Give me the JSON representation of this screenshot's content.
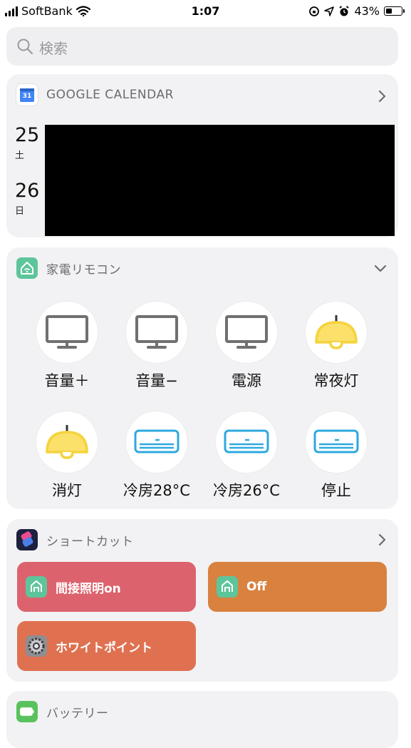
{
  "status_bar": {
    "carrier": "SoftBank",
    "time": "1:07",
    "battery_percent": "43%",
    "battery_level": 0.43
  },
  "search": {
    "placeholder": "検索",
    "icon": "search-icon"
  },
  "calendar_widget": {
    "title": "GOOGLE CALENDAR",
    "icon": "google-calendar-icon",
    "icon_day": "31",
    "days": [
      {
        "date": "25",
        "weekday": "土"
      },
      {
        "date": "26",
        "weekday": "日"
      }
    ]
  },
  "remote_widget": {
    "title": "家電リモコン",
    "icon": "home-remote-icon",
    "buttons": [
      {
        "label": "音量＋",
        "icon": "tv-icon"
      },
      {
        "label": "音量−",
        "icon": "tv-icon"
      },
      {
        "label": "電源",
        "icon": "tv-icon"
      },
      {
        "label": "常夜灯",
        "icon": "ceiling-lamp-icon"
      },
      {
        "label": "消灯",
        "icon": "ceiling-lamp-icon"
      },
      {
        "label": "冷房28°C",
        "icon": "air-conditioner-icon"
      },
      {
        "label": "冷房26°C",
        "icon": "air-conditioner-icon"
      },
      {
        "label": "停止",
        "icon": "air-conditioner-icon"
      }
    ]
  },
  "shortcuts_widget": {
    "title": "ショートカット",
    "icon": "shortcuts-icon",
    "buttons": [
      {
        "label": "間接照明on",
        "color": "#dc636d",
        "icon": "home-app-icon"
      },
      {
        "label": "Off",
        "color": "#d9813f",
        "icon": "home-app-icon"
      },
      {
        "label": "ホワイトポイント",
        "color": "#df7151",
        "icon": "settings-gear-icon"
      }
    ]
  },
  "battery_widget": {
    "title": "バッテリー",
    "icon": "battery-icon"
  },
  "colors": {
    "card_bg": "#f2f2f4",
    "lamp_yellow": "#f5d33c",
    "ac_blue": "#2ea8e0",
    "tv_gray": "#707070",
    "home_green": "#5ec59b"
  }
}
